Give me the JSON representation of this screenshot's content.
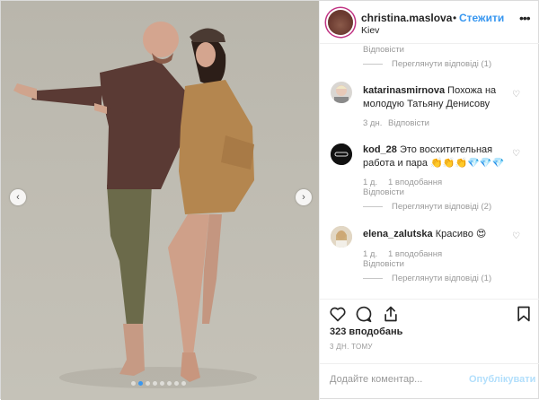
{
  "header": {
    "username": "christina.maslova",
    "bullet": "•",
    "follow_label": "Стежити",
    "location": "Kiev",
    "more_icon": "more-horizontal-icon"
  },
  "comments": {
    "top_meta": "Відповісти",
    "top_reply": "Переглянути відповіді (1)",
    "items": [
      {
        "username": "katarinasmirnova",
        "text": "Похожа на молодую Татьяну Денисову",
        "time": "3 дн.",
        "reply": "Відповісти"
      },
      {
        "username": "kod_28",
        "text": "Это восхитительная работа и пара 👏👏👏💎💎💎",
        "time": "1 д.",
        "likes": "1 вподобання",
        "reply": "Відповісти",
        "view_replies": "Переглянути відповіді (2)"
      },
      {
        "username": "elena_zalutska",
        "text": "Красиво 😍",
        "time": "1 д.",
        "likes": "1 вподобання",
        "reply": "Відповісти",
        "view_replies": "Переглянути відповіді (1)"
      }
    ]
  },
  "actions": {
    "like_icon": "heart-icon",
    "comment_icon": "comment-icon",
    "share_icon": "share-icon",
    "save_icon": "bookmark-icon",
    "likes_count": "323 вподобань",
    "time_ago": "3 ДН. ТОМУ"
  },
  "add_comment": {
    "placeholder": "Додайте коментар...",
    "publish_label": "Опублікувати"
  },
  "carousel": {
    "slide_count": 8,
    "active_index": 1
  },
  "colors": {
    "accent": "#3897f0",
    "muted": "#999999",
    "border": "#efefef",
    "publish_disabled": "#b2dffc"
  }
}
